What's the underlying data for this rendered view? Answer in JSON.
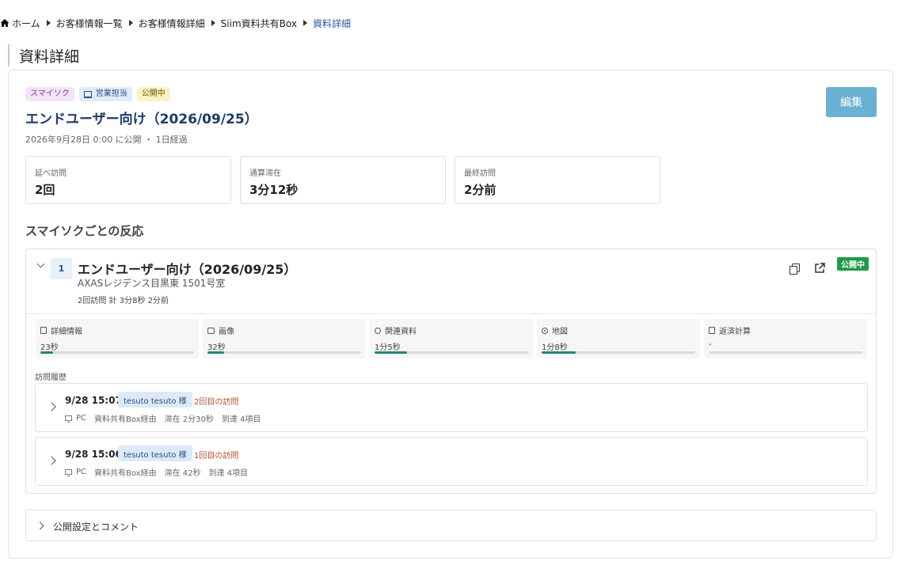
{
  "breadcrumb": {
    "items": [
      "ホーム",
      "お客様情報一覧",
      "お客様情報詳細",
      "Siim資料共有Box",
      "資料詳細"
    ]
  },
  "page_title": "資料詳細",
  "document": {
    "tags": {
      "smile": "スマイソク",
      "sales": "営業担当",
      "public": "公開中"
    },
    "title": "エンドユーザー向け（2026/09/25）",
    "meta": "2026年9月28日 0:00 に公開 ・ 1日経過",
    "edit_label": "編集"
  },
  "stats": [
    {
      "label": "延べ訪問",
      "value": "2回"
    },
    {
      "label": "通算滞在",
      "value": "3分12秒"
    },
    {
      "label": "最終訪問",
      "value": "2分前"
    }
  ],
  "reactions": {
    "heading": "スマイソクごとの反応",
    "item": {
      "number": "1",
      "title": "エンドユーザー向け（2026/09/25）",
      "subtitle": "AXASレジデンス目黒東 1501号室",
      "stats": "2回訪問  計 3分8秒  2分前",
      "status": "公開中"
    },
    "sections": [
      {
        "label": "詳細情報",
        "icon": "document-icon",
        "value": "23秒",
        "progress": 0.08
      },
      {
        "label": "画像",
        "icon": "image-icon",
        "value": "32秒",
        "progress": 0.11
      },
      {
        "label": "関連資料",
        "icon": "link-icon",
        "value": "1分5秒",
        "progress": 0.21
      },
      {
        "label": "地図",
        "icon": "map-pin-icon",
        "value": "1分8秒",
        "progress": 0.22
      },
      {
        "label": "返済計算",
        "icon": "calculator-icon",
        "value": "-",
        "progress": 0
      }
    ],
    "history_label": "訪問履歴",
    "visits": [
      {
        "time": "9/28 15:07",
        "user": "tesuto tesuto 様",
        "count": "2回目の訪問",
        "device": "PC",
        "source": "資料共有Box経由",
        "stay": "滞在 2分30秒",
        "reach": "到達 4項目"
      },
      {
        "time": "9/28 15:06",
        "user": "tesuto tesuto 様",
        "count": "1回目の訪問",
        "device": "PC",
        "source": "資料共有Box経由",
        "stay": "滞在 42秒",
        "reach": "到達 4項目"
      }
    ]
  },
  "public_settings_label": "公開設定とコメント",
  "colors": {
    "accent": "#1f3a6b",
    "edit_button": "#6ab0d2",
    "status_green": "#1f9a4a",
    "progress": "#1c8a7a"
  }
}
